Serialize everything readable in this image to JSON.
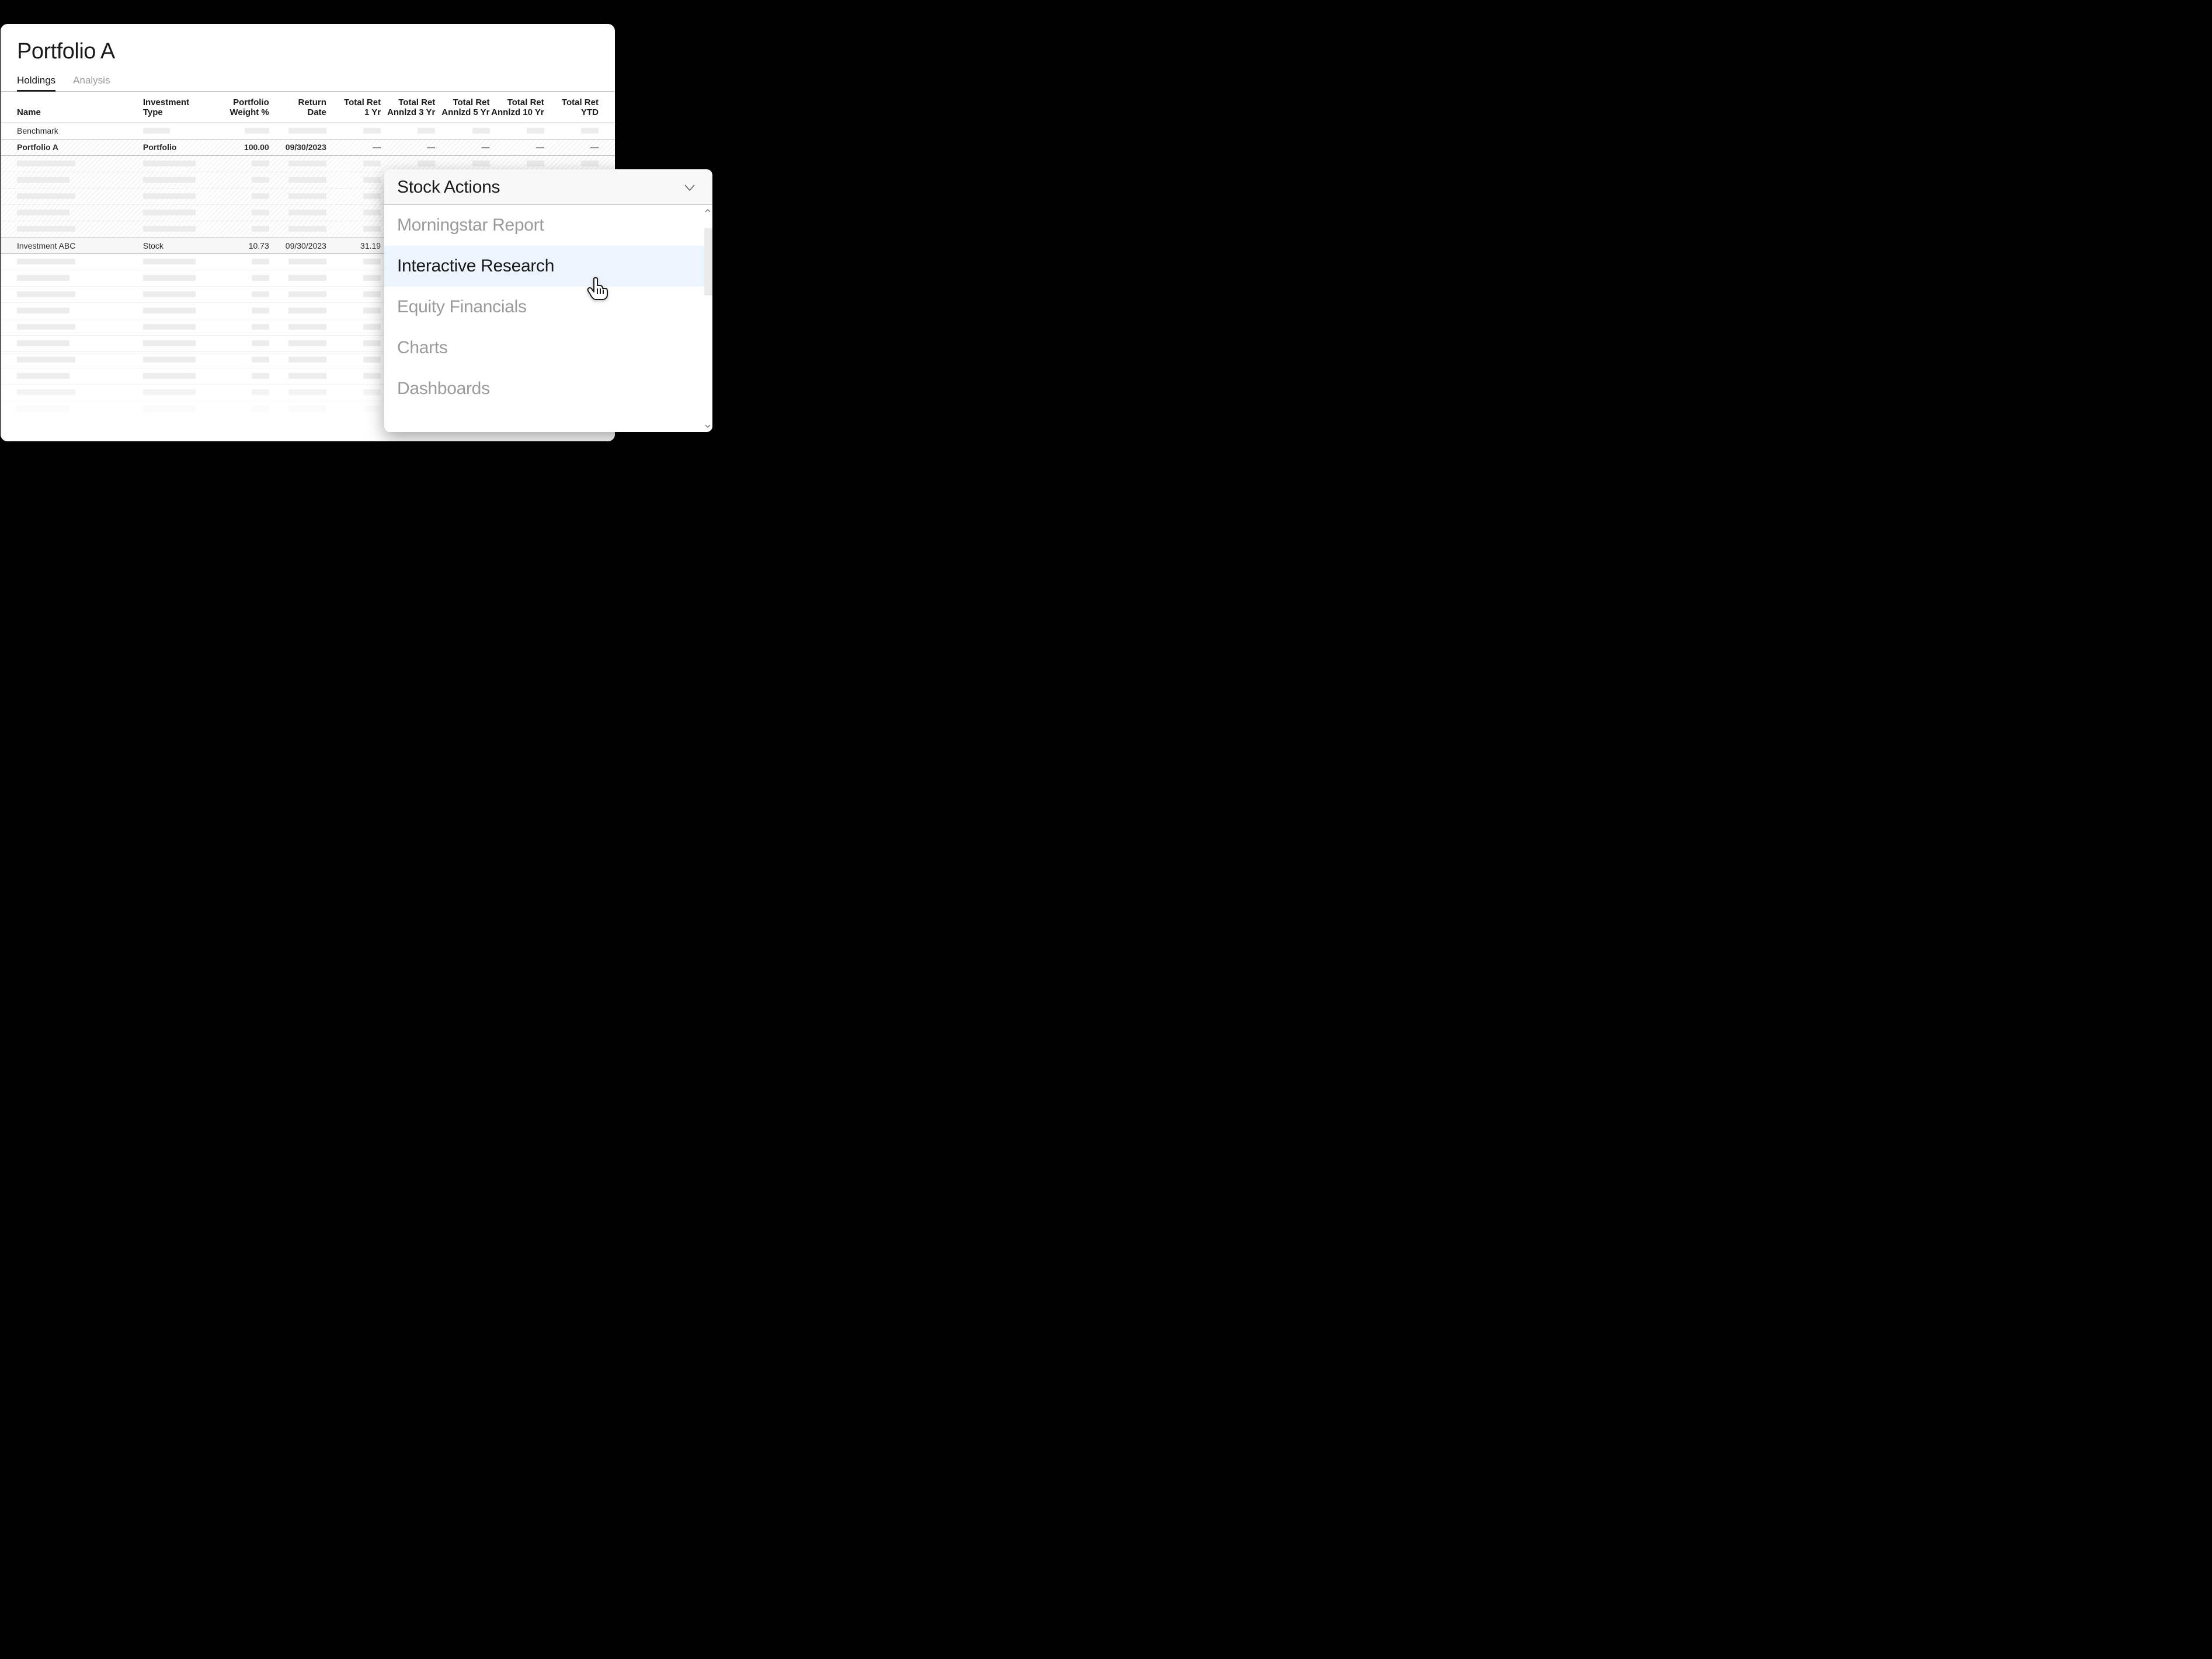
{
  "title": "Portfolio A",
  "tabs": {
    "holdings": "Holdings",
    "analysis": "Analysis"
  },
  "columns": {
    "name": "Name",
    "type": "Investment\nType",
    "pw": "Portfolio\nWeight %",
    "rdate": "Return\nDate",
    "r1": "Total Ret\n1 Yr",
    "r3": "Total Ret\nAnnlzd 3 Yr",
    "r5": "Total Ret\nAnnlzd 5 Yr",
    "r10": "Total Ret\nAnnlzd 10 Yr",
    "rytd": "Total Ret\nYTD"
  },
  "rows": {
    "benchmark": {
      "name": "Benchmark"
    },
    "portfolio": {
      "name": "Portfolio A",
      "type": "Portfolio",
      "pw": "100.00",
      "rdate": "09/30/2023",
      "r1": "—",
      "r3": "—",
      "r5": "—",
      "r10": "—",
      "rytd": "—"
    },
    "investment": {
      "name": "Investment ABC",
      "type": "Stock",
      "pw": "10.73",
      "rdate": "09/30/2023",
      "r1": "31.19"
    }
  },
  "popup": {
    "title": "Stock Actions",
    "items": {
      "report": "Morningstar Report",
      "research": "Interactive Research",
      "financials": "Equity Financials",
      "charts": "Charts",
      "dashboards": "Dashboards"
    }
  }
}
